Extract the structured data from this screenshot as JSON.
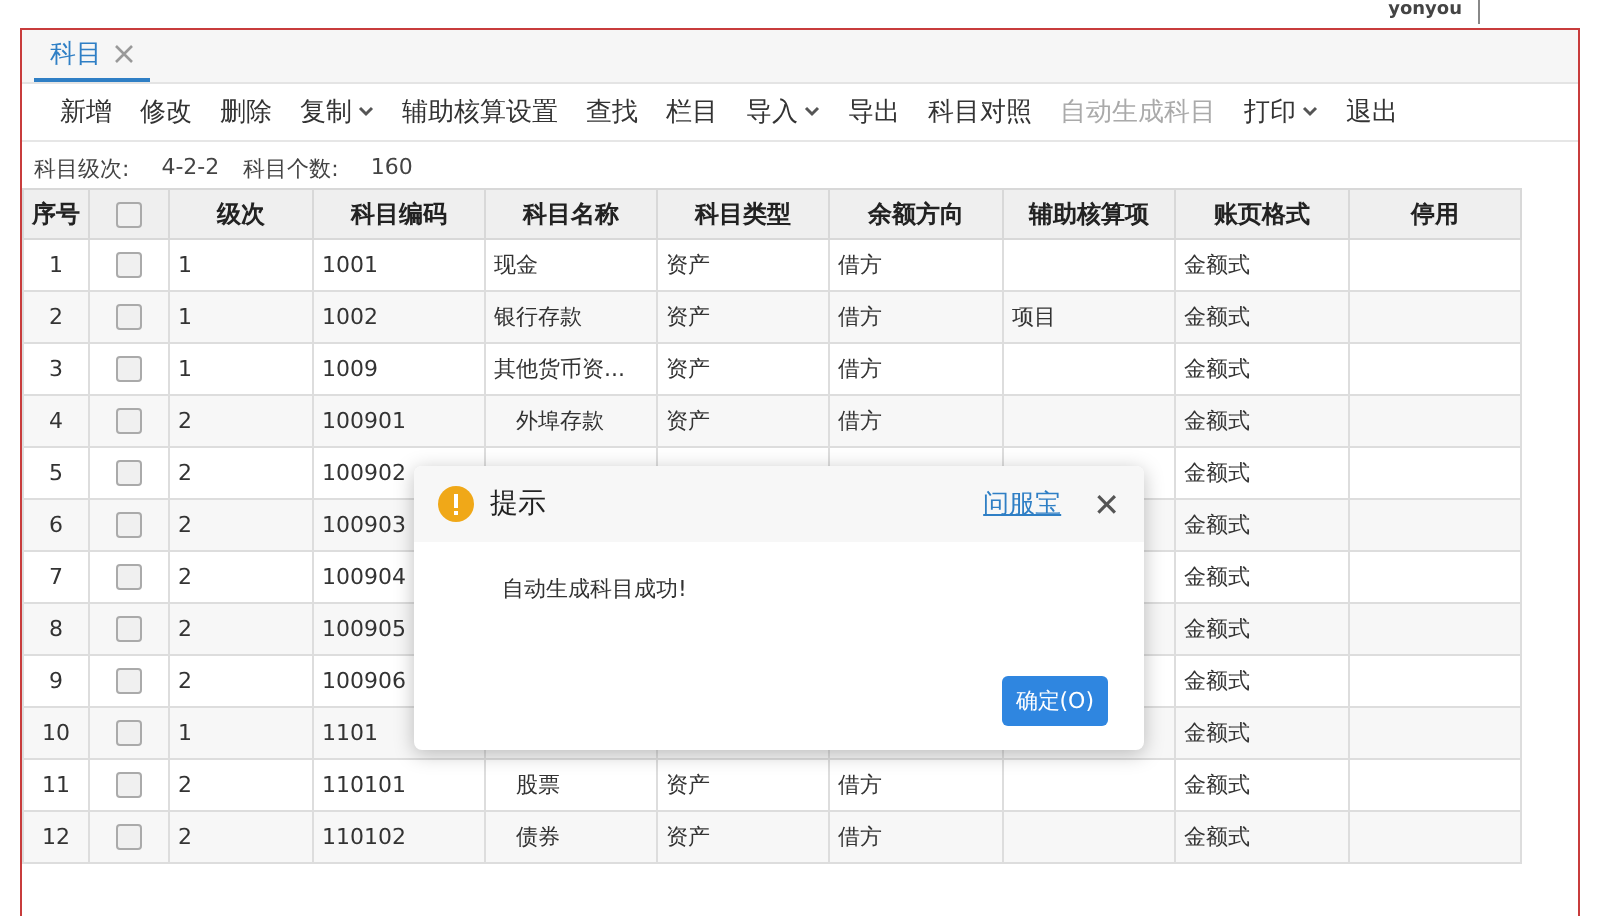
{
  "brand": "yonyou",
  "tabs": [
    {
      "label": "科目",
      "selected": true,
      "closable": true
    }
  ],
  "toolbar": [
    {
      "label": "新增",
      "disabled": false,
      "dropdown": false
    },
    {
      "label": "修改",
      "disabled": false,
      "dropdown": false
    },
    {
      "label": "删除",
      "disabled": false,
      "dropdown": false
    },
    {
      "label": "复制",
      "disabled": false,
      "dropdown": true
    },
    {
      "label": "辅助核算设置",
      "disabled": false,
      "dropdown": false
    },
    {
      "label": "查找",
      "disabled": false,
      "dropdown": false
    },
    {
      "label": "栏目",
      "disabled": false,
      "dropdown": false
    },
    {
      "label": "导入",
      "disabled": false,
      "dropdown": true
    },
    {
      "label": "导出",
      "disabled": false,
      "dropdown": false
    },
    {
      "label": "科目对照",
      "disabled": false,
      "dropdown": false
    },
    {
      "label": "自动生成科目",
      "disabled": true,
      "dropdown": false
    },
    {
      "label": "打印",
      "disabled": false,
      "dropdown": true
    },
    {
      "label": "退出",
      "disabled": false,
      "dropdown": false
    }
  ],
  "info": {
    "levels_label": "科目级次:",
    "levels": "4-2-2",
    "count_label": "科目个数:",
    "count": "160"
  },
  "table": {
    "columns": [
      "序号",
      "级次",
      "科目编码",
      "科目名称",
      "科目类型",
      "余额方向",
      "辅助核算项",
      "账页格式",
      "停用"
    ],
    "header_checked": false,
    "rows": [
      {
        "no": "1",
        "checked": false,
        "grade": "1",
        "code": "1001",
        "name": "现金",
        "type": "资产",
        "direction": "借方",
        "format": "金额式"
      },
      {
        "no": "2",
        "checked": false,
        "grade": "1",
        "code": "1002",
        "name": "银行存款",
        "type": "资产",
        "direction": "借方",
        "aux": "项目",
        "format": "金额式"
      },
      {
        "no": "3",
        "checked": false,
        "grade": "1",
        "code": "1009",
        "name": "其他货币资...",
        "type": "资产",
        "direction": "借方",
        "format": "金额式"
      },
      {
        "no": "4",
        "checked": false,
        "grade": "2",
        "code": "100901",
        "name": "外埠存款",
        "type": "资产",
        "direction": "借方",
        "format": "金额式"
      },
      {
        "no": "5",
        "checked": false,
        "grade": "2",
        "code": "100902",
        "format": "金额式"
      },
      {
        "no": "6",
        "checked": false,
        "grade": "2",
        "code": "100903",
        "format": "金额式"
      },
      {
        "no": "7",
        "checked": false,
        "grade": "2",
        "code": "100904",
        "format": "金额式"
      },
      {
        "no": "8",
        "checked": false,
        "grade": "2",
        "code": "100905",
        "format": "金额式"
      },
      {
        "no": "9",
        "checked": false,
        "grade": "2",
        "code": "100906",
        "format": "金额式"
      },
      {
        "no": "10",
        "checked": false,
        "grade": "1",
        "code": "1101",
        "format": "金额式"
      },
      {
        "no": "11",
        "checked": false,
        "grade": "2",
        "code": "110101",
        "name": "股票",
        "type": "资产",
        "direction": "借方",
        "format": "金额式"
      },
      {
        "no": "12",
        "checked": false,
        "grade": "2",
        "code": "110102",
        "name": "债券",
        "type": "资产",
        "direction": "借方",
        "format": "金额式"
      }
    ]
  },
  "dialog": {
    "title": "提示",
    "link": "问服宝",
    "close": "✕",
    "message": "自动生成科目成功!",
    "button": "确定(O)"
  }
}
